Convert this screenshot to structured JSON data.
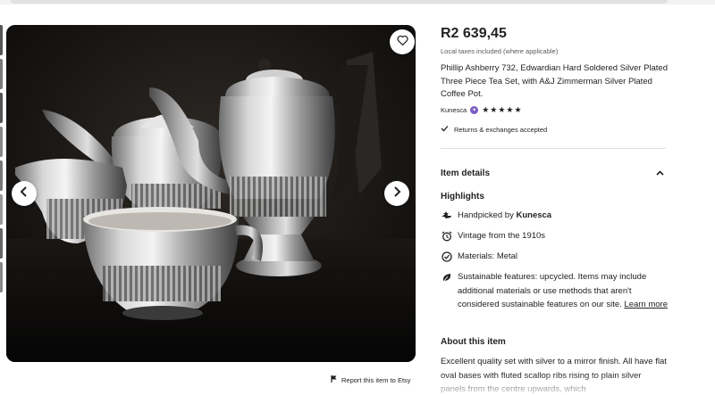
{
  "gallery": {
    "favorite_icon": "heart-outline-icon",
    "prev_icon": "chevron-left-icon",
    "next_icon": "chevron-right-icon",
    "report_label": "Report this item to Etsy",
    "report_icon": "flag-icon"
  },
  "listing": {
    "price": "R2 639,45",
    "tax_note": "Local taxes included (where applicable)",
    "title": "Phillip Ashberry 732, Edwardian Hard Soldered Silver Plated Three Piece Tea Set, with A&J Zimmerman Silver Plated Coffee Pot.",
    "shop_name": "Kunesca",
    "rating_stars": "★★★★★",
    "rating": 5,
    "returns": "Returns & exchanges accepted"
  },
  "details": {
    "heading": "Item details",
    "toggle_icon": "chevron-up-icon",
    "highlights_heading": "Highlights",
    "handpicked_prefix": "Handpicked by ",
    "handpicked_shop": "Kunesca",
    "vintage": "Vintage from the 1910s",
    "materials": "Materials: Metal",
    "sustainable": "Sustainable features: upcycled. Items may include additional materials or use methods that aren't considered sustainable features on our site. ",
    "learn_more": "Learn more"
  },
  "about": {
    "heading": "About this item",
    "text": "Excellent quality set with silver to a mirror finish. All have flat oval bases with fluted scallop ribs rising to plain silver panels from the centre upwards, which"
  },
  "colors": {
    "text": "#222222",
    "muted": "#595959",
    "badge": "#7b5cc4",
    "divider": "#e1e1e1"
  }
}
